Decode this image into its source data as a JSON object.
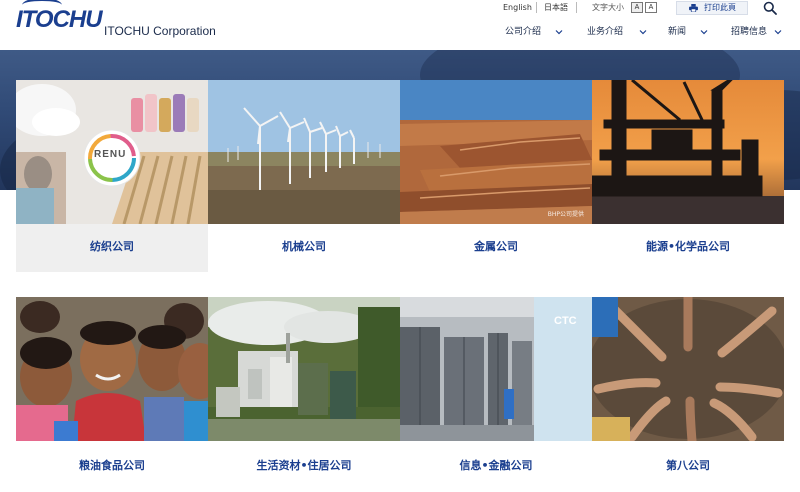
{
  "brand": {
    "logo_text": "ITOCHU",
    "corporate_name": "ITOCHU Corporation",
    "color": "#1b3f8f"
  },
  "utility": {
    "english": "English",
    "japanese": "日本語",
    "font_size_label": "文字大小",
    "font_small": "A",
    "font_large": "A",
    "print_label": "打印此頁"
  },
  "nav": [
    {
      "label": "公司介绍"
    },
    {
      "label": "业务介绍"
    },
    {
      "label": "新闻"
    },
    {
      "label": "招聘信息"
    }
  ],
  "cards": [
    {
      "label": "纺织公司",
      "photo": "textile",
      "photo_text": "RENU",
      "active": true
    },
    {
      "label": "机械公司",
      "photo": "wind-turbines"
    },
    {
      "label": "金属公司",
      "photo": "mine",
      "photo_text": "BHP公司提供"
    },
    {
      "label": "能源•化学品公司",
      "photo": "oil-platform"
    },
    {
      "label": "粮油食品公司",
      "photo": "children"
    },
    {
      "label": "生活资材•住居公司",
      "photo": "pulp-mill"
    },
    {
      "label": "信息•金融公司",
      "photo": "server-room",
      "photo_text": "CTC"
    },
    {
      "label": "第八公司",
      "photo": "hands-circle"
    }
  ]
}
